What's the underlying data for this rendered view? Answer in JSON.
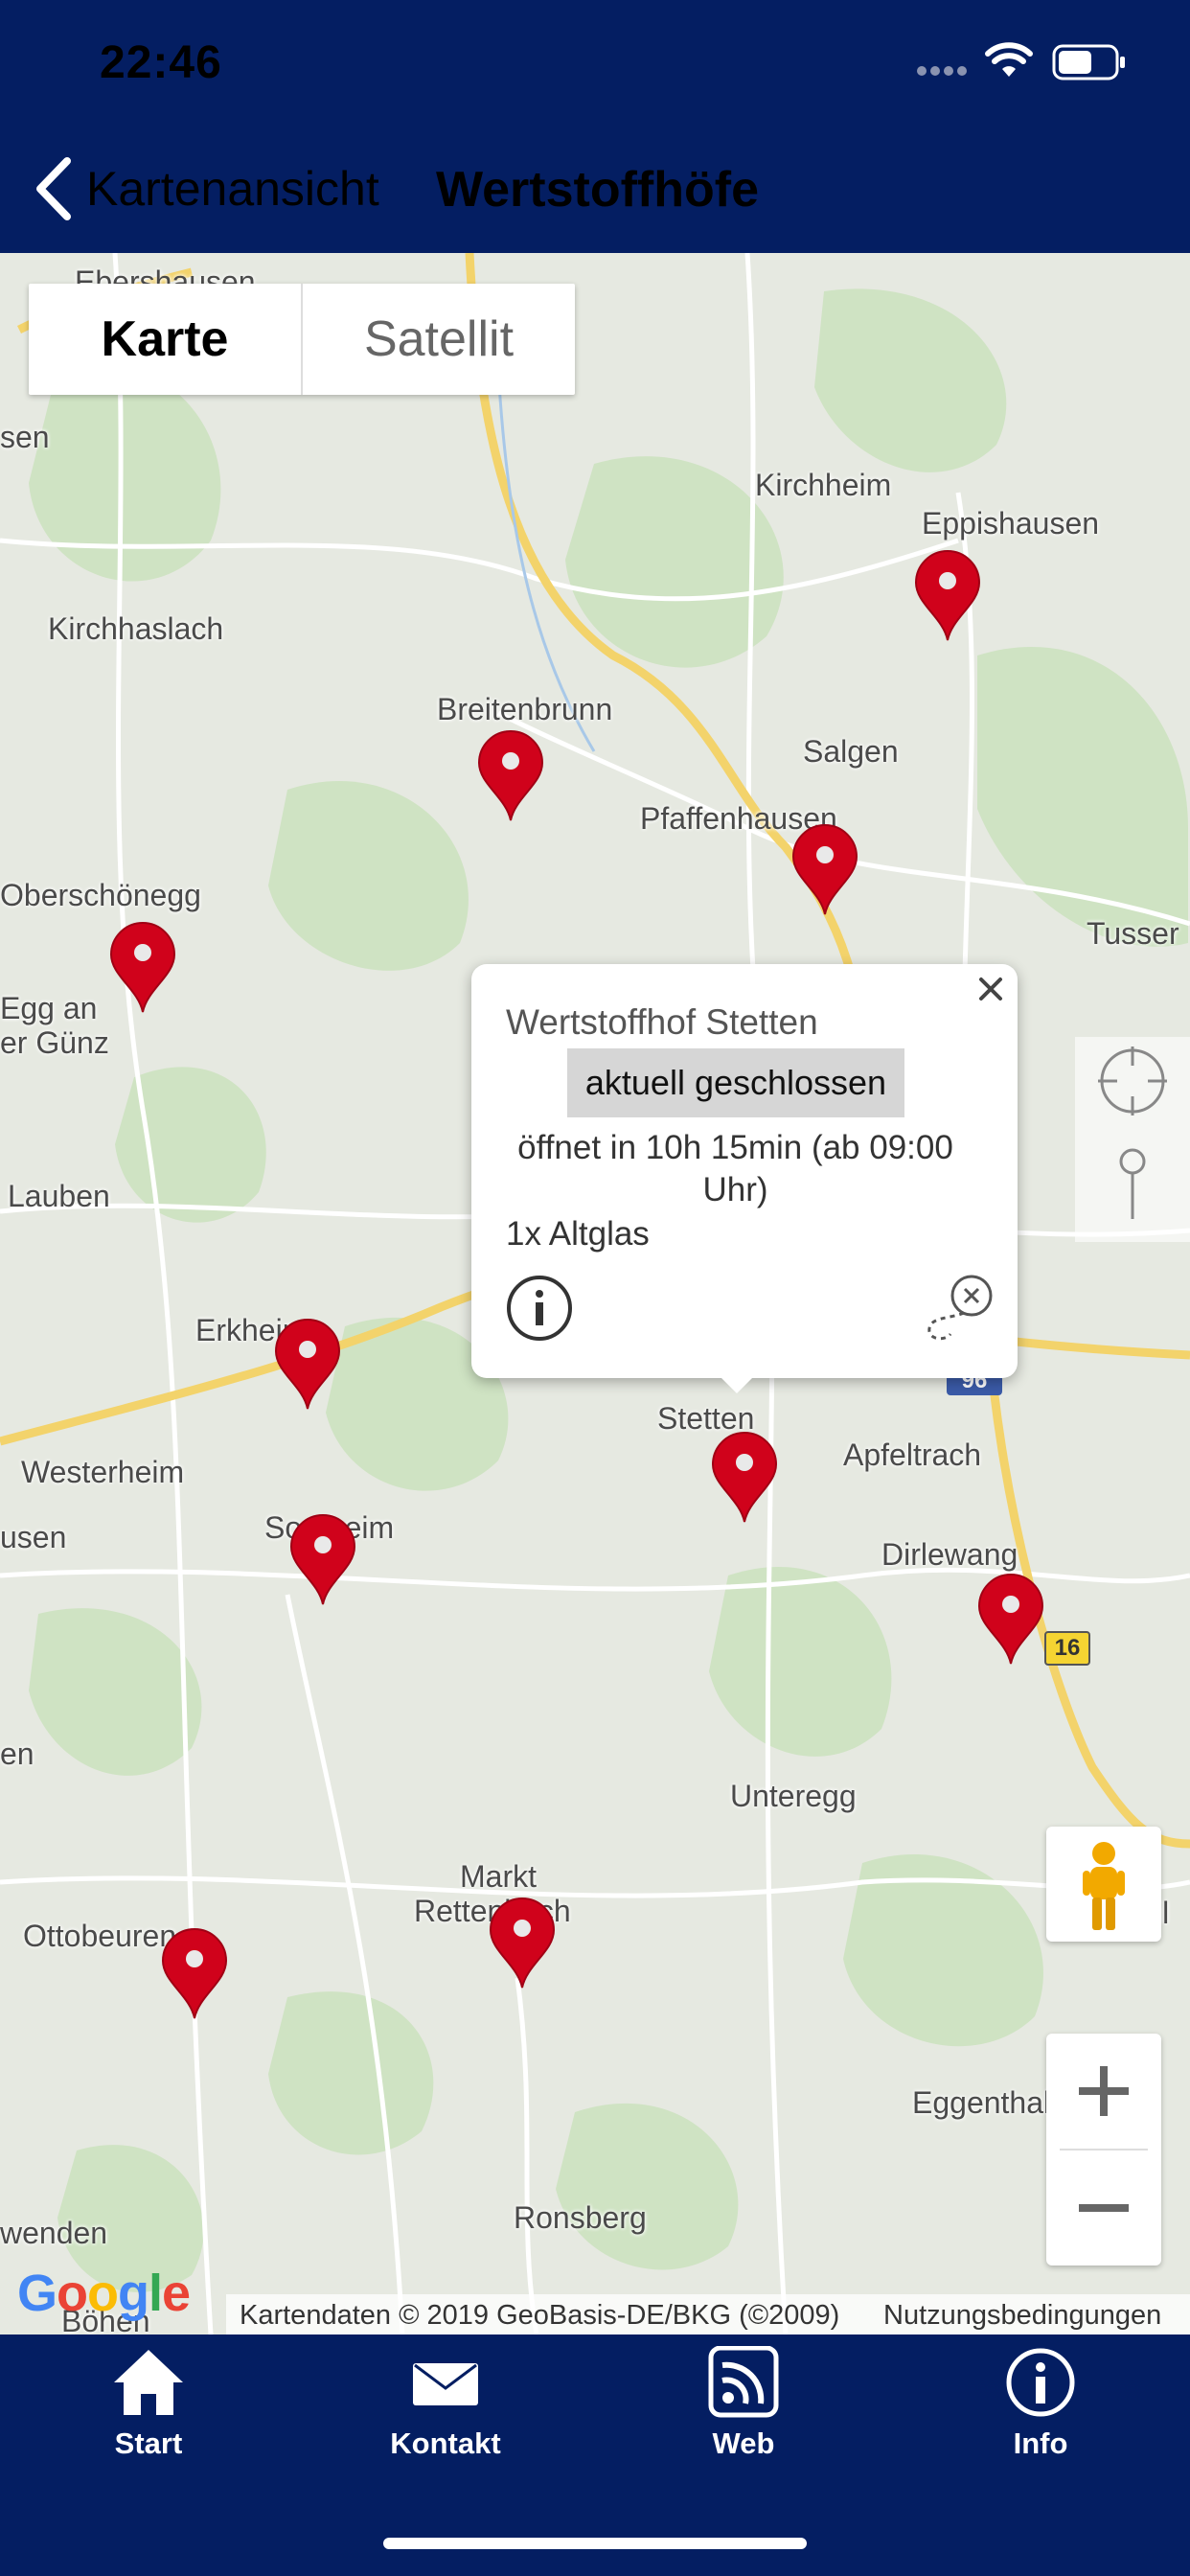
{
  "status_bar": {
    "time": "22:46"
  },
  "nav": {
    "back_label": "Kartenansicht",
    "title": "Wertstoffhöfe"
  },
  "map_type": {
    "options": [
      "Karte",
      "Satellit"
    ],
    "selected": "Karte"
  },
  "places": [
    {
      "name": "Ebershausen"
    },
    {
      "name": "sen"
    },
    {
      "name": "Kirchheim"
    },
    {
      "name": "Eppishausen"
    },
    {
      "name": "Kirchhaslach"
    },
    {
      "name": "Breitenbrunn"
    },
    {
      "name": "Salgen"
    },
    {
      "name": "Pfaffenhausen"
    },
    {
      "name": "Oberschönegg"
    },
    {
      "name": "Tusser"
    },
    {
      "name": "Egg an"
    },
    {
      "name": "er Günz"
    },
    {
      "name": "Lauben"
    },
    {
      "name": "Erkheim"
    },
    {
      "name": "Westerheim"
    },
    {
      "name": "usen"
    },
    {
      "name": "Sontheim"
    },
    {
      "name": "Stetten"
    },
    {
      "name": "Apfeltrach"
    },
    {
      "name": "Dirlewang"
    },
    {
      "name": "en"
    },
    {
      "name": "Unteregg"
    },
    {
      "name": "Markt"
    },
    {
      "name": "Rettenbach"
    },
    {
      "name": "Ottobeuren"
    },
    {
      "name": "Eggenthal"
    },
    {
      "name": "Ronsberg"
    },
    {
      "name": "wenden"
    },
    {
      "name": "il"
    },
    {
      "name": "Böhen"
    }
  ],
  "road_shields": [
    "96",
    "16"
  ],
  "popup": {
    "title": "Wertstoffhof Stetten",
    "status": "aktuell geschlossen",
    "opens": "öffnet in 10h 15min (ab 09:00 Uhr)",
    "item": "1x Altglas"
  },
  "attribution": {
    "logo": "Google",
    "data": "Kartendaten © 2019 GeoBasis-DE/BKG (©2009)",
    "terms": "Nutzungsbedingungen"
  },
  "tabs": [
    {
      "label": "Start",
      "icon": "home-icon"
    },
    {
      "label": "Kontakt",
      "icon": "mail-icon"
    },
    {
      "label": "Web",
      "icon": "rss-icon"
    },
    {
      "label": "Info",
      "icon": "info-icon"
    }
  ],
  "colors": {
    "nav_bg": "#041e62",
    "pin": "#d0021b",
    "map_bg": "#e6e9e1",
    "road_major": "#f5d76e"
  }
}
